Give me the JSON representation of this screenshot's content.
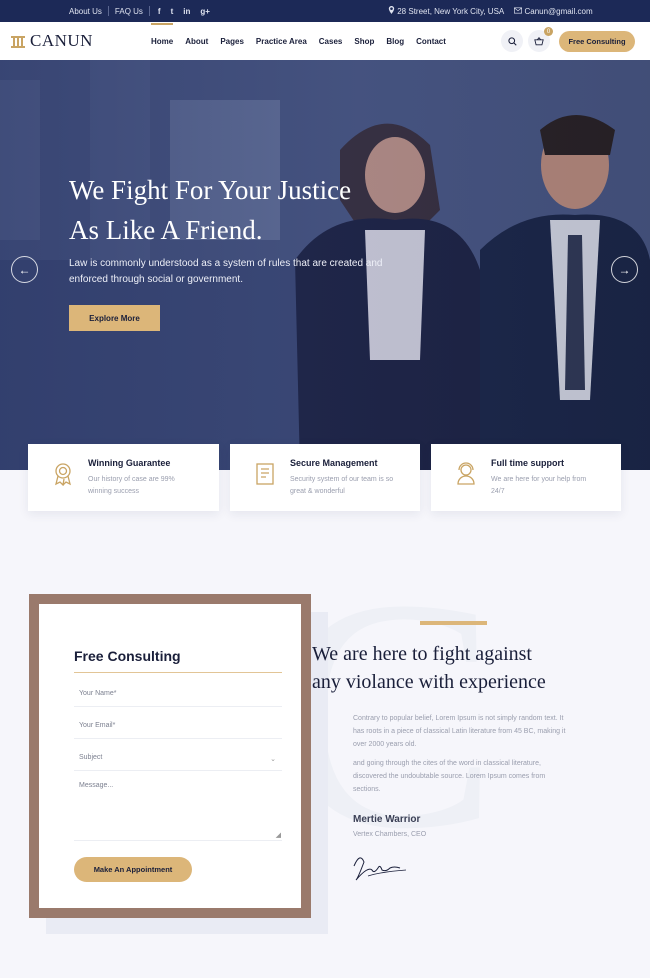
{
  "topbar": {
    "about_us": "About Us",
    "faq_us": "FAQ Us",
    "social": [
      "f",
      "t",
      "in",
      "g+"
    ],
    "address": "28 Street, New York City, USA",
    "email": "Canun@gmail.com"
  },
  "header": {
    "logo_text": "CANUN",
    "nav": [
      "Home",
      "About",
      "Pages",
      "Practice Area",
      "Cases",
      "Shop",
      "Blog",
      "Contact"
    ],
    "cart_count": "0",
    "consult_button": "Free Consulting"
  },
  "hero": {
    "title_line1": "We Fight For Your Justice",
    "title_line2": "As Like A Friend.",
    "subtitle": "Law is commonly understood as a system of rules that are created and enforced through social or government.",
    "button": "Explore More",
    "prev_arrow": "←",
    "next_arrow": "→"
  },
  "features": [
    {
      "title": "Winning Guarantee",
      "text": "Our history of case are 99% winning success",
      "icon": "award-icon"
    },
    {
      "title": "Secure Management",
      "text": "Security system of our team is so great & wonderful",
      "icon": "document-icon"
    },
    {
      "title": "Full time support",
      "text": "We are here for your help from 24/7",
      "icon": "support-agent-icon"
    }
  ],
  "form": {
    "title": "Free Consulting",
    "name_placeholder": "Your Name*",
    "email_placeholder": "Your Email*",
    "subject_placeholder": "Subject",
    "message_placeholder": "Message...",
    "button": "Make An Appointment"
  },
  "about": {
    "title_line1": "We are here to fight against",
    "title_line2": "any violance with experience",
    "para1": "Contrary to popular belief, Lorem Ipsum is not simply random text. It has roots in a piece of classical Latin literature from 45 BC, making it over 2000 years old.",
    "para2": "and going through the cites of the word in classical literature, discovered the undoubtable source. Lorem Ipsum comes from sections.",
    "name": "Mertie Warrior",
    "role": "Vertex Chambers, CEO",
    "signature": "Signature"
  },
  "colors": {
    "navy": "#1c2957",
    "gold": "#dcb679",
    "frame_brown": "#9a7a6c"
  }
}
